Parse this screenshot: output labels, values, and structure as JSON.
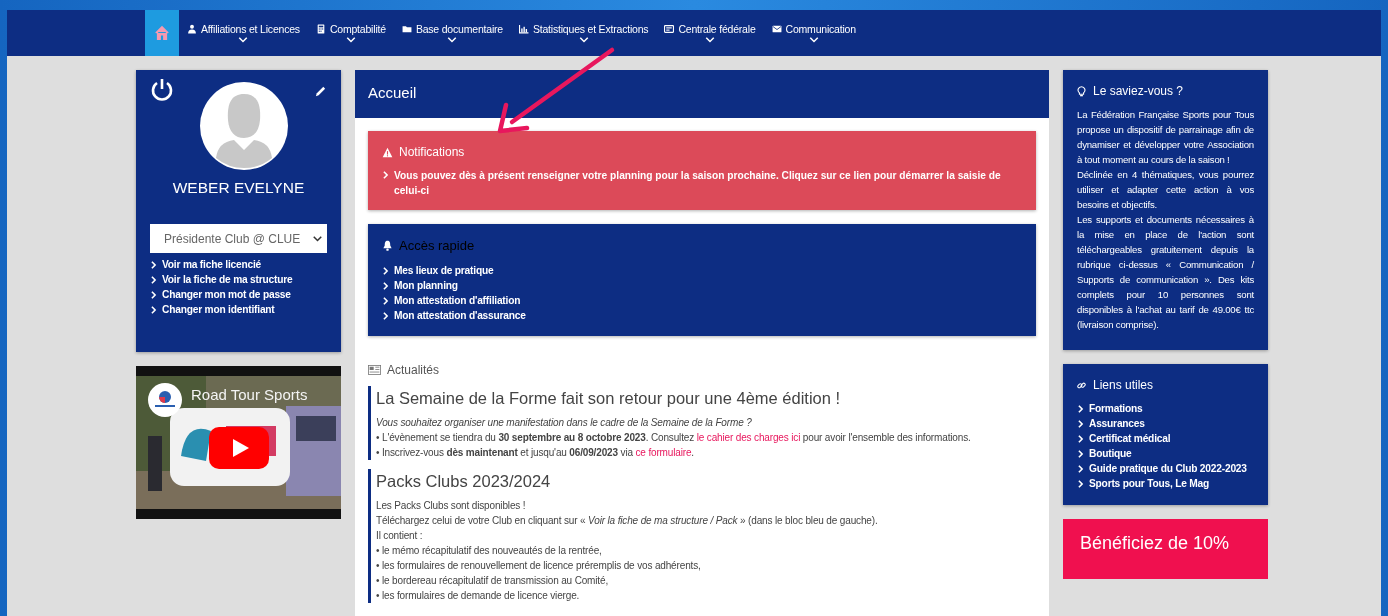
{
  "nav": {
    "items": [
      {
        "kind": "home",
        "selected": true
      },
      {
        "kind": "user",
        "label": "Affiliations et Licences",
        "selected": false
      },
      {
        "kind": "calculator",
        "label": "Comptabilité",
        "selected": false
      },
      {
        "kind": "folder",
        "label": "Base documentaire",
        "selected": false
      },
      {
        "kind": "chart",
        "label": "Statistiques et Extractions",
        "selected": false
      },
      {
        "kind": "card",
        "label": "Centrale fédérale",
        "selected": false
      },
      {
        "kind": "envelope",
        "label": "Communication",
        "selected": false
      }
    ]
  },
  "profile": {
    "name": "WEBER EVELYNE",
    "role": "Présidente Club @ CLUE",
    "links": [
      "Voir ma fiche licencié",
      "Voir la fiche de ma structure",
      "Changer mon mot de passe",
      "Changer mon identifiant"
    ]
  },
  "video": {
    "title": "Road Tour Sports"
  },
  "main": {
    "title": "Accueil",
    "notifications": {
      "title": "Notifications",
      "items": [
        "Vous pouvez dès à présent renseigner votre planning pour la saison prochaine. Cliquez sur ce lien pour démarrer la saisie de celui-ci"
      ]
    },
    "quick_access": {
      "title": "Accès rapide",
      "links": [
        "Mes lieux de pratique",
        "Mon planning",
        "Mon attestation d'affiliation",
        "Mon attestation d'assurance"
      ]
    },
    "news": {
      "title": "Actualités",
      "articles": [
        {
          "title": "La Semaine de la Forme fait son retour pour une 4ème édition !",
          "lines": [
            {
              "italic": true,
              "segments": [
                {
                  "kind": "text",
                  "text": "Vous souhaitez organiser une manifestation dans le cadre de la Semaine de la Forme ?"
                }
              ]
            },
            {
              "italic": false,
              "segments": [
                {
                  "kind": "text",
                  "text": "• L'évènement se tiendra du **30 septembre au 8 octobre 2023**. Consultez "
                },
                {
                  "kind": "link",
                  "text": "le cahier des charges ici"
                },
                {
                  "kind": "text",
                  "text": " pour avoir l'ensemble des informations."
                }
              ]
            },
            {
              "italic": false,
              "segments": [
                {
                  "kind": "text",
                  "text": "• Inscrivez-vous **dès maintenant** et jusqu'au **06/09/2023** via "
                },
                {
                  "kind": "link",
                  "text": "ce formulaire"
                },
                {
                  "kind": "text",
                  "text": "."
                }
              ]
            }
          ]
        },
        {
          "title": "Packs Clubs 2023/2024",
          "lines": [
            {
              "italic": false,
              "segments": [
                {
                  "kind": "text",
                  "text": "Les Packs Clubs sont disponibles !"
                }
              ]
            },
            {
              "italic": false,
              "segments": [
                {
                  "kind": "text",
                  "text": "Téléchargez celui de votre Club en cliquant sur « *Voir la fiche de ma structure / Pack* » (dans le bloc bleu de gauche)."
                }
              ]
            },
            {
              "italic": false,
              "segments": [
                {
                  "kind": "text",
                  "text": "Il contient :"
                }
              ]
            },
            {
              "italic": false,
              "segments": [
                {
                  "kind": "text",
                  "text": "• le mémo récapitulatif des nouveautés de la rentrée,"
                }
              ]
            },
            {
              "italic": false,
              "segments": [
                {
                  "kind": "text",
                  "text": "• les formulaires de renouvellement de licence préremplis de vos adhérents,"
                }
              ]
            },
            {
              "italic": false,
              "segments": [
                {
                  "kind": "text",
                  "text": "• le bordereau récapitulatif de transmission au Comité,"
                }
              ]
            },
            {
              "italic": false,
              "segments": [
                {
                  "kind": "text",
                  "text": "• les formulaires de demande de licence vierge."
                }
              ]
            }
          ]
        }
      ]
    }
  },
  "tips": {
    "title": "Le saviez-vous ?",
    "paragraphs": [
      "La Fédération Française Sports pour Tous propose un dispositif de parrainage afin de dynamiser et développer votre Association à tout moment au cours de la saison !",
      "Déclinée en 4 thématiques, vous pourrez utiliser et adapter cette action à vos besoins et objectifs.",
      "Les supports et documents nécessaires à la mise en place de l'action sont téléchargeables gratuitement depuis la rubrique ci-dessus « Communication / Supports de communication ». Des kits complets pour 10 personnes sont disponibles à l'achat au tarif de 49.00€ ttc (livraison comprise)."
    ]
  },
  "useful_links": {
    "title": "Liens utiles",
    "links": [
      "Formations",
      "Assurances",
      "Certificat médical",
      "Boutique",
      "Guide pratique du Club 2022-2023",
      "Sports pour Tous, Le Mag"
    ]
  },
  "promo": {
    "text": "Bénéficiez de 10%"
  }
}
